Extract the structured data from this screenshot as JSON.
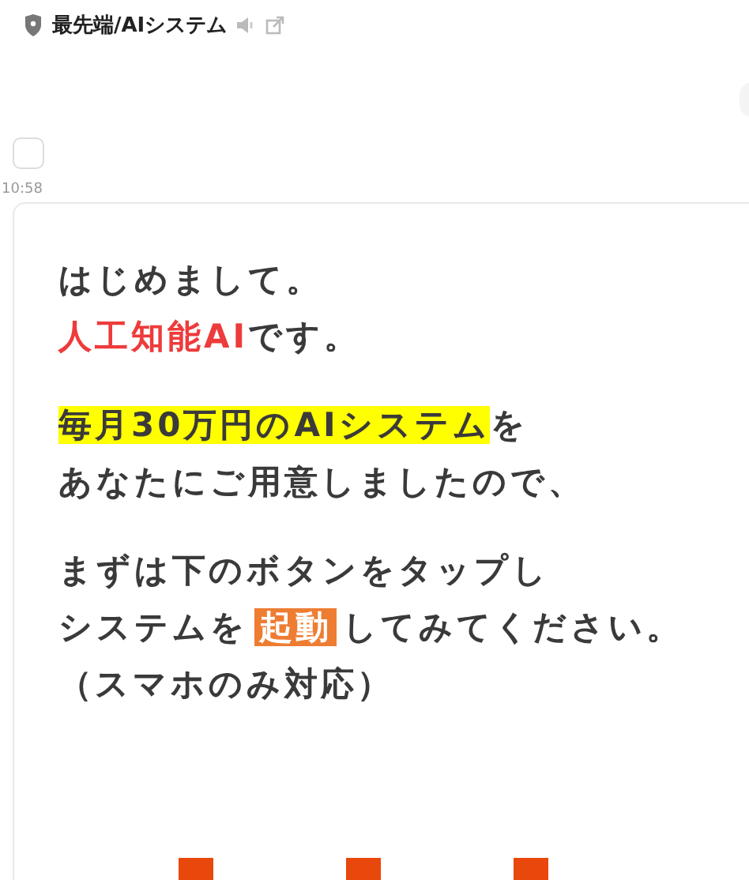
{
  "header": {
    "title": "最先端/AIシステム"
  },
  "time": "10:58",
  "message": {
    "paragraphs": [
      {
        "lines": [
          [
            {
              "kind": "plain",
              "text": "はじめまして。"
            }
          ],
          [
            {
              "kind": "red",
              "text": "人工知能AI"
            },
            {
              "kind": "plain",
              "text": "です。"
            }
          ]
        ]
      },
      {
        "lines": [
          [
            {
              "kind": "highlight",
              "text": "毎月30万円のAIシステム"
            },
            {
              "kind": "plain",
              "text": "を"
            }
          ],
          [
            {
              "kind": "plain",
              "text": "あなたにご用意しましたので、"
            }
          ]
        ]
      },
      {
        "lines": [
          [
            {
              "kind": "plain",
              "text": "まずは下のボタンをタップし"
            }
          ],
          [
            {
              "kind": "plain",
              "text": "システムを"
            },
            {
              "kind": "badge",
              "text": "起動"
            },
            {
              "kind": "plain",
              "text": "してみてください。"
            }
          ],
          [
            {
              "kind": "plain",
              "text": "（スマホのみ対応）"
            }
          ]
        ]
      }
    ]
  }
}
